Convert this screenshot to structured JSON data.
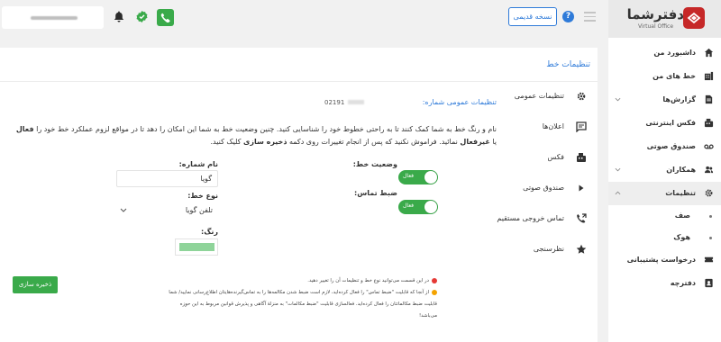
{
  "app": {
    "logo_text": "دفترشما",
    "logo_sub": "Virtual Office",
    "accent": "#2f7bd9",
    "brand": "#c62828",
    "success": "#3aaa4a"
  },
  "header": {
    "old_version_label": "نسخه قدیمی",
    "help_icon": "?"
  },
  "sidebar": {
    "items": [
      {
        "label": "داشبورد من",
        "icon": "home-icon"
      },
      {
        "label": "خط های من",
        "icon": "phone-lines-icon"
      },
      {
        "label": "گزارش‌ها",
        "icon": "report-icon"
      },
      {
        "label": "فکس اینترنتی",
        "icon": "fax-icon"
      },
      {
        "label": "صندوق صوتی",
        "icon": "voicemail-icon"
      },
      {
        "label": "همکاران",
        "icon": "users-icon"
      },
      {
        "label": "تنظیمات",
        "icon": "gear-icon"
      }
    ],
    "sub_items": [
      {
        "label": "صف"
      },
      {
        "label": "هوک"
      }
    ],
    "bottom_items": [
      {
        "label": "درخواست پشتیبانی",
        "icon": "ticket-icon"
      },
      {
        "label": "دفترچه",
        "icon": "contacts-icon"
      }
    ]
  },
  "main": {
    "title": "تنظیمات خط",
    "tabs": [
      {
        "label": "تنظیمات عمومی",
        "icon": "gear-icon"
      },
      {
        "label": "اعلان‌ها",
        "icon": "message-icon"
      },
      {
        "label": "فکس",
        "icon": "fax-icon"
      },
      {
        "label": "صندوق صوتی",
        "icon": "play-icon"
      },
      {
        "label": "تماس خروجی مستقیم",
        "icon": "phone-outgoing-icon"
      },
      {
        "label": "نظرسنجی",
        "icon": "star-icon"
      }
    ],
    "general": {
      "title": "تنظیمات عمومی شماره:",
      "number": "02191",
      "desc_1": "نام و رنگ خط به شما کمک کنند تا به راحتی خطوط خود را شناسایی کنید. چنین وضعیت خط به شما این امکان را دهد تا در مواقع لزوم عملکرد خط",
      "desc_2a": "خود را ",
      "desc_active": "فعال",
      "desc_or": " یا ",
      "desc_inactive": "غیرفعال",
      "desc_2b": " نمائید. فراموش نکنید که پس از انجام تغییرات روی دکمه ",
      "desc_save": "ذخیره سازی",
      "desc_2c": " کلیک کنید.",
      "line_status_label": "وضعیت خط:",
      "line_status_value": "فعال",
      "record_label": "ضبط تماس:",
      "record_value": "فعال",
      "name_label": "نام شماره:",
      "name_value": "گویا",
      "type_label": "نوع خط:",
      "type_value": "تلفن گویا",
      "color_label": "رنگ:",
      "color_value": "#8fd49a"
    },
    "save_label": "ذخیره سازی",
    "notes": [
      "در این قسمت می‌توانید نوع خط و تنظیمات آن را تغییر دهید.",
      "از آنجا که قابلیت \"ضبط تماس\" را فعال کرده‌اید، لازم است ضبط شدن مکالمه‌ها را به تماس‌گیرنده‌هایتان اطلاع‌رسانی نمایید/ شما",
      "قابلیت ضبط مکالماتتان را فعال کرده‌اید. فعالسازی قابلیت \"ضبط مکالمات\" به منزلهٔ آگاهی و پذیرش قوانین مربوط به این حوزه",
      "می‌باشد!"
    ]
  }
}
